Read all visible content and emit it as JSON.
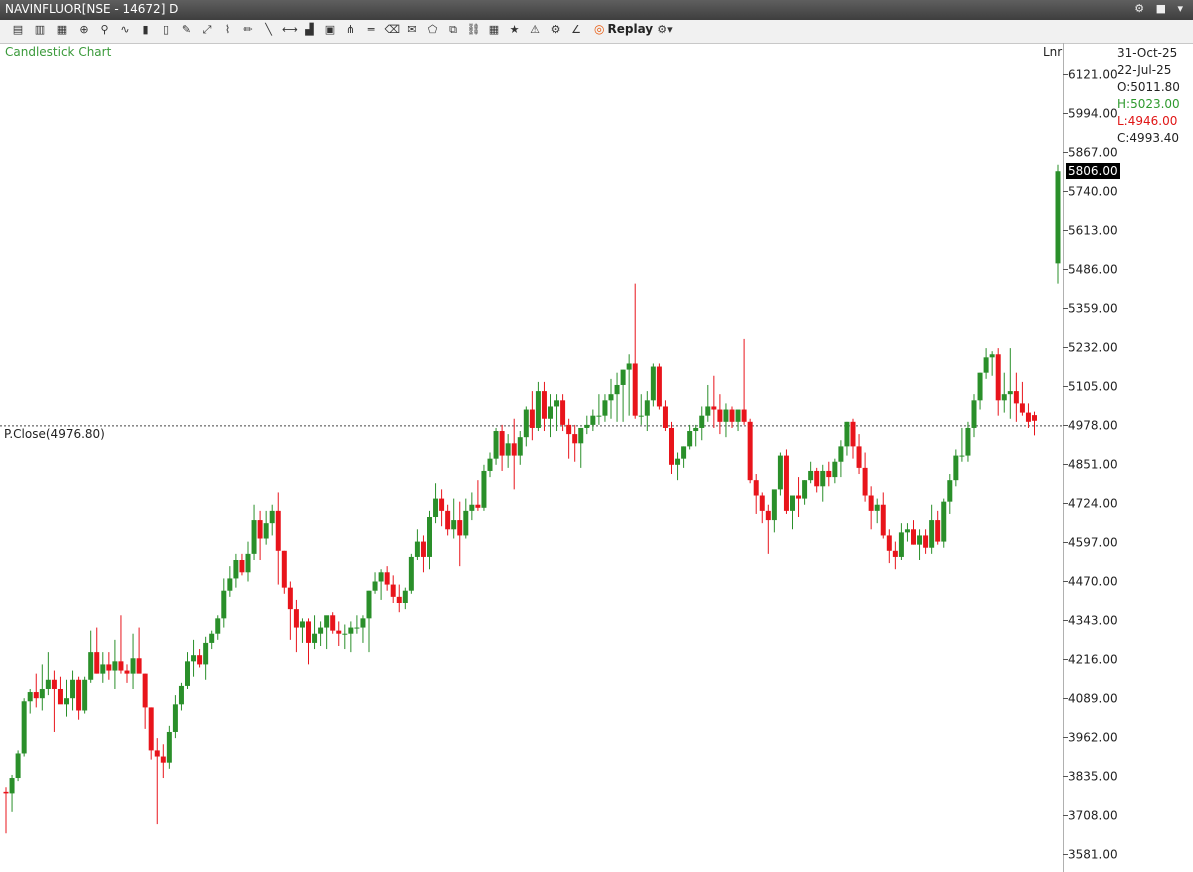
{
  "window": {
    "title": "NAVINFLUOR[NSE - 14672] D"
  },
  "toolbar": {
    "icons": [
      "easy-icon",
      "buy-icon",
      "txt-icon",
      "crosshair-icon",
      "pointer-icon",
      "indicator-icon",
      "bar-chart-icon",
      "candle-icon",
      "draw-icon",
      "trend-icon",
      "ruler-icon",
      "pencil-icon",
      "line-icon",
      "arrow-line-icon",
      "volume-icon",
      "cube-icon",
      "fib-icon",
      "hline-icon",
      "eraser-icon",
      "note-icon",
      "shape-icon",
      "copy-icon",
      "link-icon",
      "layout-icon",
      "star-icon",
      "alert-icon",
      "strategy-icon",
      "trend-chart-icon"
    ],
    "replay_label": "Replay"
  },
  "chart_data": {
    "type": "candlestick",
    "title": "Candlestick Chart",
    "scale": "Lnr",
    "ylim": [
      3550,
      6190
    ],
    "yticks": [
      6121,
      5994,
      5867,
      5740,
      5613,
      5486,
      5359,
      5232,
      5105,
      4978,
      4851,
      4724,
      4597,
      4470,
      4343,
      4216,
      4089,
      3962,
      3835,
      3708,
      3581
    ],
    "ytick_labels": [
      "6121.00",
      "5994.00",
      "5867.00",
      "5740.00",
      "5613.00",
      "5486.00",
      "5359.00",
      "5232.00",
      "5105.00",
      "4978.00",
      "4851.00",
      "4724.00",
      "4597.00",
      "4470.00",
      "4343.00",
      "4216.00",
      "4089.00",
      "3962.00",
      "3835.00",
      "3708.00",
      "3581.00"
    ],
    "prev_close": {
      "label": "P.Close(4976.80)",
      "value": 4976.8
    },
    "last_price": {
      "label": "5806.00",
      "value": 5806
    },
    "ohlc_info": {
      "current_date": "31-Oct-25",
      "hover_date": "22-Jul-25",
      "open": "O:5011.80",
      "high": "H:5023.00",
      "low": "L:4946.00",
      "close": "C:4993.40"
    },
    "candles": [
      [
        3785,
        3800,
        3650,
        3780
      ],
      [
        3780,
        3840,
        3720,
        3830
      ],
      [
        3830,
        3920,
        3820,
        3910
      ],
      [
        3910,
        4090,
        3900,
        4080
      ],
      [
        4080,
        4120,
        4040,
        4110
      ],
      [
        4110,
        4170,
        4060,
        4090
      ],
      [
        4090,
        4200,
        4050,
        4120
      ],
      [
        4120,
        4240,
        4100,
        4150
      ],
      [
        4150,
        4180,
        3980,
        4120
      ],
      [
        4120,
        4160,
        4080,
        4070
      ],
      [
        4070,
        4150,
        4030,
        4090
      ],
      [
        4090,
        4180,
        4050,
        4150
      ],
      [
        4150,
        4160,
        4020,
        4050
      ],
      [
        4050,
        4160,
        4040,
        4150
      ],
      [
        4150,
        4310,
        4140,
        4240
      ],
      [
        4240,
        4320,
        4170,
        4170
      ],
      [
        4170,
        4240,
        4140,
        4200
      ],
      [
        4200,
        4240,
        4150,
        4180
      ],
      [
        4180,
        4280,
        4120,
        4210
      ],
      [
        4210,
        4360,
        4170,
        4180
      ],
      [
        4180,
        4200,
        4140,
        4170
      ],
      [
        4170,
        4300,
        4120,
        4220
      ],
      [
        4220,
        4320,
        4200,
        4170
      ],
      [
        4170,
        4170,
        3990,
        4060
      ],
      [
        4060,
        4060,
        3890,
        3920
      ],
      [
        3920,
        3960,
        3680,
        3900
      ],
      [
        3900,
        3940,
        3830,
        3880
      ],
      [
        3880,
        4000,
        3860,
        3980
      ],
      [
        3980,
        4100,
        3960,
        4070
      ],
      [
        4070,
        4140,
        4050,
        4130
      ],
      [
        4130,
        4240,
        4120,
        4210
      ],
      [
        4210,
        4280,
        4160,
        4230
      ],
      [
        4230,
        4250,
        4190,
        4200
      ],
      [
        4200,
        4290,
        4150,
        4270
      ],
      [
        4270,
        4310,
        4250,
        4300
      ],
      [
        4300,
        4360,
        4280,
        4350
      ],
      [
        4350,
        4480,
        4320,
        4440
      ],
      [
        4440,
        4520,
        4420,
        4480
      ],
      [
        4480,
        4560,
        4450,
        4540
      ],
      [
        4540,
        4560,
        4490,
        4500
      ],
      [
        4500,
        4600,
        4470,
        4560
      ],
      [
        4560,
        4720,
        4540,
        4670
      ],
      [
        4670,
        4700,
        4540,
        4610
      ],
      [
        4610,
        4700,
        4590,
        4660
      ],
      [
        4660,
        4720,
        4620,
        4700
      ],
      [
        4700,
        4760,
        4460,
        4570
      ],
      [
        4570,
        4570,
        4430,
        4450
      ],
      [
        4450,
        4470,
        4280,
        4380
      ],
      [
        4380,
        4410,
        4240,
        4320
      ],
      [
        4320,
        4350,
        4270,
        4340
      ],
      [
        4340,
        4350,
        4200,
        4270
      ],
      [
        4270,
        4360,
        4250,
        4300
      ],
      [
        4300,
        4340,
        4260,
        4320
      ],
      [
        4320,
        4350,
        4250,
        4360
      ],
      [
        4360,
        4370,
        4300,
        4310
      ],
      [
        4310,
        4340,
        4260,
        4300
      ],
      [
        4300,
        4330,
        4250,
        4300
      ],
      [
        4300,
        4340,
        4240,
        4320
      ],
      [
        4320,
        4360,
        4300,
        4320
      ],
      [
        4320,
        4360,
        4270,
        4350
      ],
      [
        4350,
        4440,
        4240,
        4440
      ],
      [
        4440,
        4500,
        4430,
        4470
      ],
      [
        4470,
        4510,
        4410,
        4500
      ],
      [
        4500,
        4520,
        4440,
        4460
      ],
      [
        4460,
        4490,
        4400,
        4420
      ],
      [
        4420,
        4460,
        4370,
        4400
      ],
      [
        4400,
        4450,
        4380,
        4440
      ],
      [
        4440,
        4560,
        4430,
        4550
      ],
      [
        4550,
        4640,
        4540,
        4600
      ],
      [
        4600,
        4620,
        4500,
        4550
      ],
      [
        4550,
        4700,
        4510,
        4680
      ],
      [
        4680,
        4790,
        4660,
        4740
      ],
      [
        4740,
        4770,
        4650,
        4700
      ],
      [
        4700,
        4720,
        4620,
        4640
      ],
      [
        4640,
        4740,
        4610,
        4670
      ],
      [
        4670,
        4730,
        4520,
        4620
      ],
      [
        4620,
        4740,
        4610,
        4700
      ],
      [
        4700,
        4760,
        4670,
        4720
      ],
      [
        4720,
        4800,
        4700,
        4710
      ],
      [
        4710,
        4850,
        4700,
        4830
      ],
      [
        4830,
        4890,
        4810,
        4870
      ],
      [
        4870,
        4970,
        4850,
        4960
      ],
      [
        4960,
        4980,
        4830,
        4880
      ],
      [
        4880,
        4950,
        4840,
        4920
      ],
      [
        4920,
        5000,
        4770,
        4880
      ],
      [
        4880,
        4960,
        4850,
        4940
      ],
      [
        4940,
        5040,
        4910,
        5030
      ],
      [
        5030,
        5090,
        4930,
        4970
      ],
      [
        4970,
        5120,
        4960,
        5090
      ],
      [
        5090,
        5120,
        4960,
        5000
      ],
      [
        5000,
        5080,
        4940,
        5040
      ],
      [
        5040,
        5080,
        4960,
        5060
      ],
      [
        5060,
        5080,
        4960,
        4980
      ],
      [
        4980,
        5000,
        4870,
        4950
      ],
      [
        4950,
        4980,
        4860,
        4920
      ],
      [
        4920,
        4970,
        4840,
        4970
      ],
      [
        4970,
        5010,
        4950,
        4980
      ],
      [
        4980,
        5030,
        4960,
        5010
      ],
      [
        5010,
        5080,
        4980,
        5010
      ],
      [
        5010,
        5080,
        4990,
        5060
      ],
      [
        5060,
        5130,
        5000,
        5080
      ],
      [
        5080,
        5150,
        4990,
        5110
      ],
      [
        5110,
        5160,
        4990,
        5160
      ],
      [
        5160,
        5210,
        5010,
        5180
      ],
      [
        5180,
        5440,
        5000,
        5010
      ],
      [
        5010,
        5080,
        4980,
        5010
      ],
      [
        5010,
        5090,
        4960,
        5060
      ],
      [
        5060,
        5180,
        5040,
        5170
      ],
      [
        5170,
        5180,
        5030,
        5040
      ],
      [
        5040,
        5060,
        4960,
        4970
      ],
      [
        4970,
        4990,
        4820,
        4850
      ],
      [
        4850,
        4890,
        4800,
        4870
      ],
      [
        4870,
        4910,
        4840,
        4910
      ],
      [
        4910,
        4980,
        4900,
        4960
      ],
      [
        4960,
        4980,
        4910,
        4970
      ],
      [
        4970,
        5040,
        4930,
        5010
      ],
      [
        5010,
        5110,
        4990,
        5040
      ],
      [
        5040,
        5140,
        4970,
        5030
      ],
      [
        5030,
        5080,
        4950,
        4990
      ],
      [
        4990,
        5050,
        4940,
        5030
      ],
      [
        5030,
        5040,
        4970,
        4990
      ],
      [
        4990,
        5020,
        4960,
        5030
      ],
      [
        5030,
        5260,
        4980,
        4990
      ],
      [
        4990,
        5000,
        4790,
        4800
      ],
      [
        4800,
        4820,
        4690,
        4750
      ],
      [
        4750,
        4760,
        4660,
        4700
      ],
      [
        4700,
        4720,
        4560,
        4670
      ],
      [
        4670,
        4720,
        4630,
        4770
      ],
      [
        4770,
        4890,
        4750,
        4880
      ],
      [
        4880,
        4900,
        4690,
        4700
      ],
      [
        4700,
        4720,
        4640,
        4750
      ],
      [
        4750,
        4810,
        4680,
        4740
      ],
      [
        4740,
        4800,
        4720,
        4800
      ],
      [
        4800,
        4860,
        4790,
        4830
      ],
      [
        4830,
        4840,
        4760,
        4780
      ],
      [
        4780,
        4850,
        4730,
        4830
      ],
      [
        4830,
        4860,
        4780,
        4810
      ],
      [
        4810,
        4870,
        4790,
        4860
      ],
      [
        4860,
        4930,
        4810,
        4910
      ],
      [
        4910,
        4990,
        4880,
        4990
      ],
      [
        4990,
        5000,
        4870,
        4910
      ],
      [
        4910,
        4950,
        4820,
        4840
      ],
      [
        4840,
        4890,
        4730,
        4750
      ],
      [
        4750,
        4780,
        4640,
        4700
      ],
      [
        4700,
        4740,
        4660,
        4720
      ],
      [
        4720,
        4760,
        4610,
        4620
      ],
      [
        4620,
        4640,
        4530,
        4570
      ],
      [
        4570,
        4600,
        4510,
        4550
      ],
      [
        4550,
        4660,
        4540,
        4630
      ],
      [
        4630,
        4660,
        4600,
        4640
      ],
      [
        4640,
        4670,
        4590,
        4590
      ],
      [
        4590,
        4640,
        4540,
        4620
      ],
      [
        4620,
        4640,
        4560,
        4580
      ],
      [
        4580,
        4720,
        4560,
        4670
      ],
      [
        4670,
        4700,
        4590,
        4600
      ],
      [
        4600,
        4740,
        4580,
        4730
      ],
      [
        4730,
        4820,
        4690,
        4800
      ],
      [
        4800,
        4900,
        4780,
        4880
      ],
      [
        4880,
        4970,
        4860,
        4880
      ],
      [
        4880,
        4990,
        4860,
        4970
      ],
      [
        4970,
        5080,
        4940,
        5060
      ],
      [
        5060,
        5150,
        5030,
        5150
      ],
      [
        5150,
        5230,
        5130,
        5200
      ],
      [
        5200,
        5220,
        5140,
        5210
      ],
      [
        5210,
        5230,
        5010,
        5060
      ],
      [
        5060,
        5150,
        5020,
        5080
      ],
      [
        5080,
        5230,
        5000,
        5090
      ],
      [
        5090,
        5150,
        4990,
        5050
      ],
      [
        5050,
        5120,
        5010,
        5020
      ],
      [
        5020,
        5050,
        4970,
        4990
      ],
      [
        5011.8,
        5023,
        4946,
        4993.4
      ],
      [
        5506,
        5827,
        5440,
        5806
      ]
    ]
  }
}
